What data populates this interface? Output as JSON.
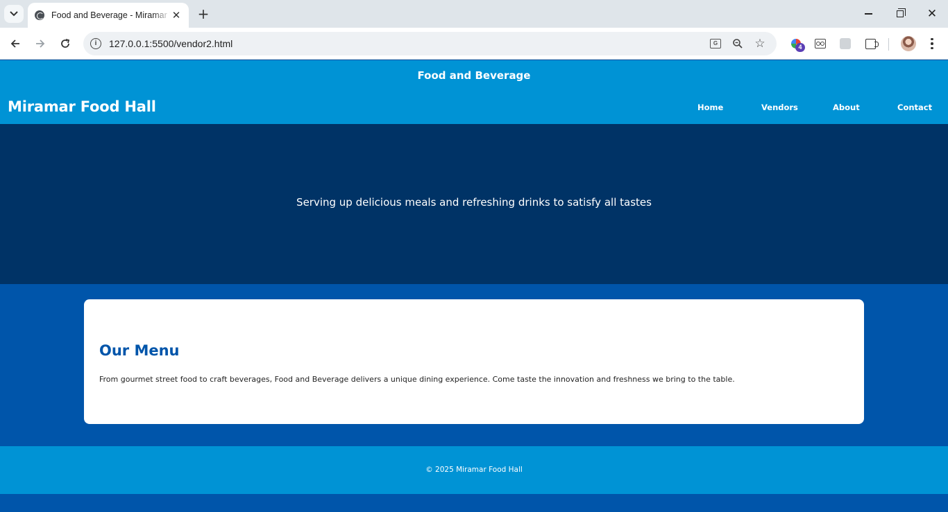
{
  "browser": {
    "tab_title": "Food and Beverage - Miramar Vendors",
    "tab_close": "✕",
    "new_tab": "+",
    "url": "127.0.0.1:5500/vendor2.html",
    "extension_badge": "4",
    "icons": [
      "tab-search-icon",
      "back-arrow-icon",
      "forward-arrow-icon",
      "reload-icon",
      "site-info-icon",
      "translate-icon",
      "zoom-icon",
      "bookmark-star-icon",
      "extension-icon",
      "puzzle-icon",
      "profile-avatar",
      "more-menu-icon",
      "minimize-icon",
      "maximize-icon",
      "close-icon"
    ]
  },
  "header": {
    "banner_title": "Food and Beverage",
    "brand": "Miramar Food Hall",
    "nav": {
      "home": "Home",
      "vendors": "Vendors",
      "about": "About",
      "contact": "Contact"
    }
  },
  "hero": {
    "tagline": "Serving up delicious meals and refreshing drinks to satisfy all tastes"
  },
  "menu_section": {
    "title": "Our Menu",
    "body": "From gourmet street food to craft beverages, Food and Beverage delivers a unique dining experience. Come taste the innovation and freshness we bring to the table."
  },
  "footer": {
    "text": "© 2025 Miramar Food Hall"
  },
  "colors": {
    "header_bg": "#0093d5",
    "hero_bg": "#003366",
    "page_bg": "#0055aa",
    "card_bg": "#ffffff",
    "heading": "#0055aa"
  }
}
